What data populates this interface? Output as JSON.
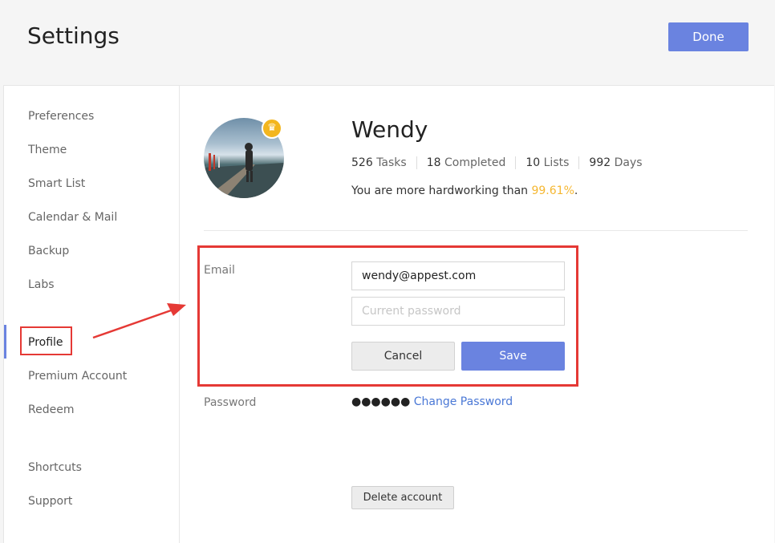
{
  "header": {
    "title": "Settings",
    "done_label": "Done"
  },
  "sidebar": {
    "items": [
      {
        "label": "Preferences"
      },
      {
        "label": "Theme"
      },
      {
        "label": "Smart List"
      },
      {
        "label": "Calendar & Mail"
      },
      {
        "label": "Backup"
      },
      {
        "label": "Labs"
      },
      {
        "label": "Profile",
        "active": true
      },
      {
        "label": "Premium Account"
      },
      {
        "label": "Redeem"
      },
      {
        "label": "Shortcuts"
      },
      {
        "label": "Support"
      }
    ]
  },
  "profile": {
    "name": "Wendy",
    "badge_icon": "crown-icon",
    "stats": [
      {
        "value": "526",
        "label": "Tasks"
      },
      {
        "value": "18",
        "label": "Completed"
      },
      {
        "value": "10",
        "label": "Lists"
      },
      {
        "value": "992",
        "label": "Days"
      }
    ],
    "hardwork_prefix": "You are more hardworking than ",
    "hardwork_pct": "99.61%",
    "hardwork_suffix": "."
  },
  "account": {
    "email_label": "Email",
    "email_value": "wendy@appest.com",
    "password_placeholder": "Current password",
    "cancel_label": "Cancel",
    "save_label": "Save",
    "password_label": "Password",
    "password_mask": "●●●●●●",
    "change_password_label": "Change Password",
    "delete_label": "Delete account"
  },
  "colors": {
    "accent": "#6a83e0",
    "highlight": "#f5b731",
    "annotation": "#e53935",
    "link": "#4a78d6"
  }
}
